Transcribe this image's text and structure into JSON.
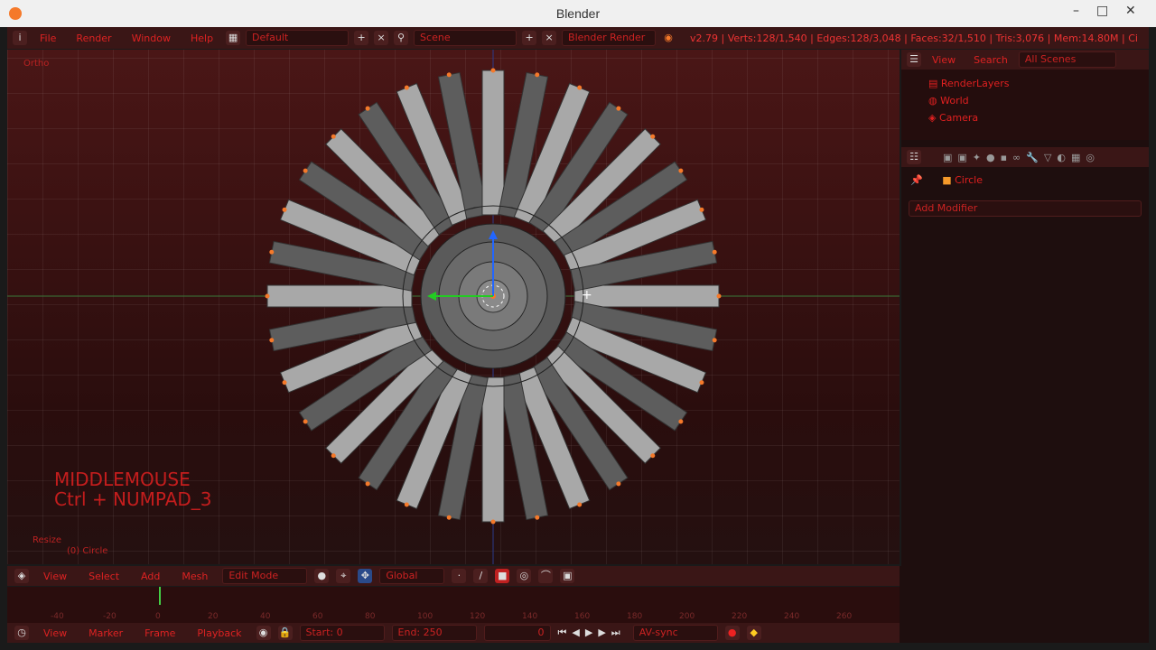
{
  "window": {
    "title": "Blender",
    "minimize": "–",
    "maximize": "□",
    "close": "✕"
  },
  "topbar": {
    "menus": [
      "File",
      "Render",
      "Window",
      "Help"
    ],
    "layout": "Default",
    "scene": "Scene",
    "engine": "Blender Render",
    "stats": "v2.79 | Verts:128/1,540 | Edges:128/3,048 | Faces:32/1,510 | Tris:3,076 | Mem:14.80M | Ci"
  },
  "viewport": {
    "view_label": "Ortho",
    "operator_label": "Resize",
    "object_label": "(0) Circle",
    "key_hint_line1": "MIDDLEMOUSE",
    "key_hint_line2": "Ctrl + NUMPAD_3"
  },
  "outliner": {
    "view": "View",
    "search": "Search",
    "filter": "All Scenes",
    "items": [
      "RenderLayers",
      "World",
      "Camera"
    ]
  },
  "properties": {
    "object_name": "Circle",
    "add_modifier": "Add Modifier"
  },
  "header": {
    "view": "View",
    "select": "Select",
    "add": "Add",
    "mesh": "Mesh",
    "mode": "Edit Mode",
    "orientation": "Global"
  },
  "timeline": {
    "ticks": [
      "-40",
      "-20",
      "0",
      "20",
      "40",
      "60",
      "80",
      "100",
      "120",
      "140",
      "160",
      "180",
      "200",
      "220",
      "240",
      "260"
    ],
    "view": "View",
    "marker": "Marker",
    "frame": "Frame",
    "playback": "Playback",
    "start_label": "Start:",
    "start": "0",
    "end_label": "End:",
    "end": "250",
    "current": "0",
    "sync": "AV-sync"
  }
}
